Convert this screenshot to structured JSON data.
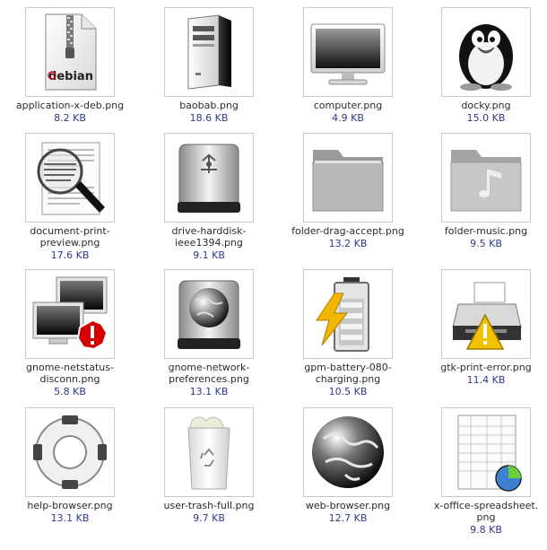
{
  "files": [
    {
      "name": "application-x-deb.png",
      "size": "8.2 KB",
      "icon": "debian-package-icon",
      "badge_text": "debian"
    },
    {
      "name": "baobab.png",
      "size": "18.6 KB",
      "icon": "server-tower-icon"
    },
    {
      "name": "computer.png",
      "size": "4.9 KB",
      "icon": "monitor-icon"
    },
    {
      "name": "docky.png",
      "size": "15.0 KB",
      "icon": "penguin-icon"
    },
    {
      "name": "document-print-\npreview.png",
      "size": "17.6 KB",
      "icon": "magnifier-document-icon"
    },
    {
      "name": "drive-harddisk-\nieee1394.png",
      "size": "9.1 KB",
      "icon": "firewire-drive-icon"
    },
    {
      "name": "folder-drag-accept.png",
      "size": "13.2 KB",
      "icon": "folder-icon"
    },
    {
      "name": "folder-music.png",
      "size": "9.5 KB",
      "icon": "music-folder-icon"
    },
    {
      "name": "gnome-netstatus-\ndisconn.png",
      "size": "5.8 KB",
      "icon": "network-disconnected-icon"
    },
    {
      "name": "gnome-network-\npreferences.png",
      "size": "13.1 KB",
      "icon": "network-drive-globe-icon"
    },
    {
      "name": "gpm-battery-080-\ncharging.png",
      "size": "10.5 KB",
      "icon": "battery-charging-icon"
    },
    {
      "name": "gtk-print-error.png",
      "size": "11.4 KB",
      "icon": "printer-warning-icon"
    },
    {
      "name": "help-browser.png",
      "size": "13.1 KB",
      "icon": "lifebuoy-icon"
    },
    {
      "name": "user-trash-full.png",
      "size": "9.7 KB",
      "icon": "trash-full-icon"
    },
    {
      "name": "web-browser.png",
      "size": "12.7 KB",
      "icon": "globe-icon"
    },
    {
      "name": "x-office-spreadsheet.\npng",
      "size": "9.8 KB",
      "icon": "spreadsheet-icon"
    }
  ]
}
